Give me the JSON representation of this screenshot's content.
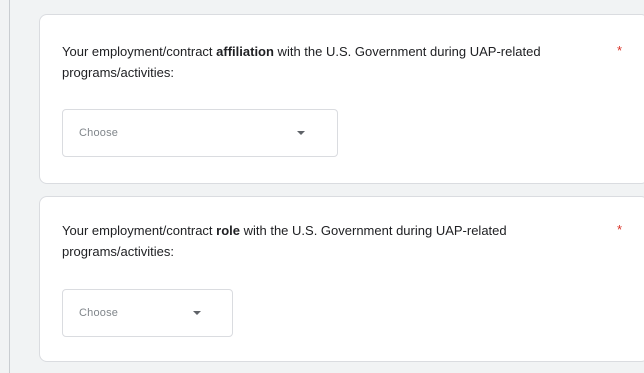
{
  "questions": [
    {
      "text_before": "Your employment/contract ",
      "bold": "affiliation",
      "text_after": " with the U.S. Government during UAP-related programs/activities:",
      "required_marker": "*",
      "dropdown": {
        "selected": "Choose"
      }
    },
    {
      "text_before": "Your employment/contract ",
      "bold": "role",
      "text_after": " with the U.S. Government during UAP-related programs/activities:",
      "required_marker": "*",
      "dropdown": {
        "selected": "Choose"
      }
    }
  ],
  "icons": {
    "dropdown_caret": "chevron-down-icon"
  },
  "colors": {
    "page_background": "#f1f3f4",
    "card_background": "#ffffff",
    "required": "#d93025",
    "text": "#202124",
    "placeholder": "#80868b"
  }
}
